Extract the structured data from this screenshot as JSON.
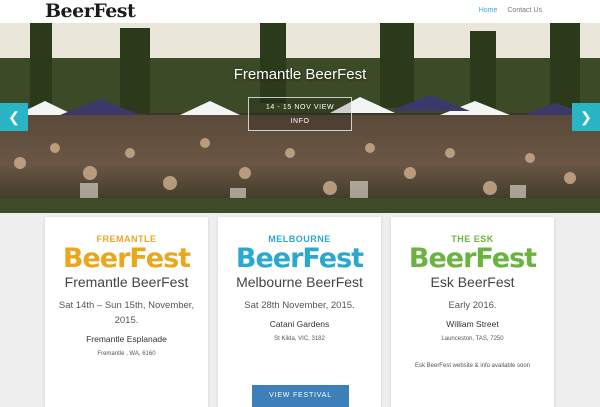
{
  "header": {
    "logo": "BeerFest",
    "nav": [
      {
        "label": "Home",
        "active": true
      },
      {
        "label": "Contact Us",
        "active": false
      }
    ]
  },
  "hero": {
    "title": "Fremantle BeerFest",
    "button_line1": "14 - 15 NOV VIEW",
    "button_line2": "INFO",
    "prev_arrow": "❮",
    "next_arrow": "❯"
  },
  "cards": [
    {
      "badge": "FREMANTLE",
      "wordmark": "BeerFest",
      "color": "#e9a71d",
      "badge_color": "#e9a71d",
      "name": "Fremantle BeerFest",
      "date": "Sat 14th – Sun 15th, November, 2015.",
      "venue": "Fremantle Esplanade",
      "address": "Fremantle , WA, 6160"
    },
    {
      "badge": "MELBOURNE",
      "wordmark": "BeerFest",
      "color": "#2aa9d0",
      "badge_color": "#2aa9d0",
      "name": "Melbourne BeerFest",
      "date": "Sat 28th November, 2015.",
      "venue": "Catani Gardens",
      "address": "St Kilda, VIC, 3182",
      "button": "VIEW FESTIVAL"
    },
    {
      "badge": "THE ESK",
      "wordmark": "BeerFest",
      "color": "#6ab33e",
      "badge_color": "#6ab33e",
      "name": "Esk BeerFest",
      "date": "Early 2016.",
      "venue": "William Street",
      "address": "Launceston, TAS, 7250",
      "note": "Esk BeerFest website & info available soon"
    }
  ]
}
